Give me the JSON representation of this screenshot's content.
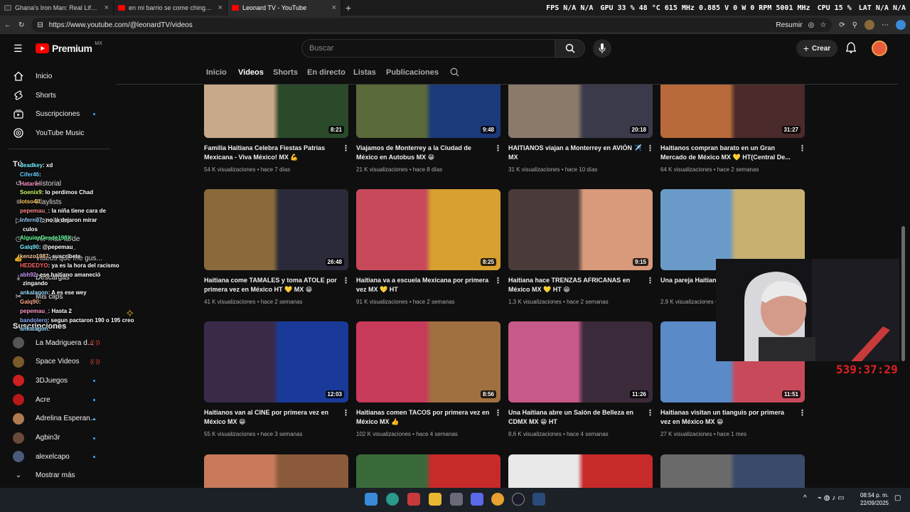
{
  "browser": {
    "tabs": [
      {
        "title": "Ghana's Iron Man: Real Life Waka",
        "active": false
      },
      {
        "title": "en mi barrio se come chingon - Yo",
        "active": false
      },
      {
        "title": "Leonard TV - YouTube",
        "active": true
      }
    ],
    "url": "https://www.youtube.com/@leonardTV/videos",
    "resumir": "Resumir"
  },
  "hud": {
    "fps_label": "FPS",
    "fps1": "N/A",
    "fps2": "N/A",
    "gpu_label": "GPU",
    "gpu_pct": "33 %",
    "gpu_temp": "48 °C",
    "gpu_clock": "615 MHz",
    "gpu_volt": "0.885 V",
    "gpu_watt": "0 W",
    "gpu_rpm": "0 RPM",
    "gpu_mem": "5001 MHz",
    "cpu_label": "CPU",
    "cpu_pct": "15 %",
    "lat_label": "LAT",
    "lat1": "N/A",
    "lat2": "N/A"
  },
  "youtube": {
    "logo": "Premium",
    "region": "MX",
    "search_placeholder": "Buscar",
    "create_label": "Crear"
  },
  "sidebar": {
    "main": [
      {
        "label": "Inicio",
        "icon": "home-icon"
      },
      {
        "label": "Shorts",
        "icon": "shorts-icon"
      },
      {
        "label": "Suscripciones",
        "icon": "subscriptions-icon"
      },
      {
        "label": "YouTube Music",
        "icon": "music-icon"
      }
    ],
    "you_label": "Tú",
    "you_items": [
      {
        "label": "Historial"
      },
      {
        "label": "Playlists"
      },
      {
        "label": "Tus videos"
      },
      {
        "label": "Ver más tarde"
      },
      {
        "label": "Videos que me gus..."
      },
      {
        "label": "Descargas"
      },
      {
        "label": "Mis clips"
      }
    ],
    "subs_label": "Suscripciones",
    "subs": [
      {
        "name": "La Madriguera d...",
        "live": true,
        "color": "#555"
      },
      {
        "name": "Space Videos",
        "live": true,
        "color": "#7a5a2a"
      },
      {
        "name": "3DJuegos",
        "live": false,
        "color": "#cc1f1f"
      },
      {
        "name": "Acre",
        "live": false,
        "color": "#b81818"
      },
      {
        "name": "Adrelina Esperan...",
        "live": false,
        "color": "#b07a50"
      },
      {
        "name": "Agbin3r",
        "live": false,
        "color": "#6a4a3a"
      },
      {
        "name": "alexelcapo",
        "live": false,
        "color": "#4a5a7a"
      }
    ],
    "show_more": "Mostrar más"
  },
  "chat": [
    {
      "user": "deadkey",
      "text": ": xd"
    },
    {
      "user": "Cifer46",
      "text": ":"
    },
    {
      "user": "Hatariel",
      "text": ""
    },
    {
      "user": "Soenix9",
      "text": ": lo perdimos Chad"
    },
    {
      "user": "lotso4d",
      "text": ""
    },
    {
      "user": "pepemau_",
      "text": ": la niña tiene cara de"
    },
    {
      "user": "Inferno7",
      "text": ": no la dejaron mirar"
    },
    {
      "user": "",
      "text": "culos"
    },
    {
      "user": "AlguienDesde198X",
      "text": ":"
    },
    {
      "user": "Galq90",
      "text": ": @pepemau_"
    },
    {
      "user": "kenzo1987",
      "text": ": suscribete"
    },
    {
      "user": "HEDEDYO",
      "text": ": ya es la hora del racismo"
    },
    {
      "user": "abh92",
      "text": ": ese haitiano amaneció"
    },
    {
      "user": "",
      "text": "zingando"
    },
    {
      "user": "ankalagon",
      "text": ": A es ese wey"
    },
    {
      "user": "Galq90",
      "text": ":"
    },
    {
      "user": "pepemau_",
      "text": ": Hasta 2"
    },
    {
      "user": "bandolero",
      "text": ": segun pactaron 190 o 195 creo"
    },
    {
      "user": "ankalagon",
      "text": ":"
    }
  ],
  "channel_tabs": [
    "Inicio",
    "Videos",
    "Shorts",
    "En directo",
    "Listas",
    "Publicaciones"
  ],
  "active_tab": "Videos",
  "videos": [
    {
      "title": "Familia Haitiana Celebra Fiestas Patrias Mexicana - Viva México! MX 💪",
      "views": "54 K visualizaciones",
      "age": "hace 7 días",
      "duration": "8:21",
      "c1": "#c8a98a",
      "c2": "#2a4a2a"
    },
    {
      "title": "Viajamos de Monterrey a la Ciudad de México en Autobus MX 😁",
      "views": "21 K visualizaciones",
      "age": "hace 8 días",
      "duration": "9:48",
      "c1": "#5a6a3a",
      "c2": "#1a3a7a"
    },
    {
      "title": "HAITIANOS viajan a Monterrey en AVIÓN ✈️ MX",
      "views": "31 K visualizaciones",
      "age": "hace 10 días",
      "duration": "20:18",
      "c1": "#8a7a6a",
      "c2": "#3a3a4a"
    },
    {
      "title": "Haitianos compran barato en un Gran Mercado de México MX 💛 HT(Central De...",
      "views": "64 K visualizaciones",
      "age": "hace 2 semanas",
      "duration": "31:27",
      "c1": "#b86a3a",
      "c2": "#4a2a2a"
    },
    {
      "title": "Haitiana come TAMALES y toma ATOLE por primera vez en México HT 💛 MX 😁",
      "views": "41 K visualizaciones",
      "age": "hace 2 semanas",
      "duration": "26:48",
      "c1": "#8a6a3a",
      "c2": "#2a2a3a"
    },
    {
      "title": "Haitiana va a escuela Mexicana por primera vez MX 💛 HT",
      "views": "91 K visualizaciones",
      "age": "hace 2 semanas",
      "duration": "8:25",
      "c1": "#c84a5a",
      "c2": "#d8a030"
    },
    {
      "title": "Haitiana hace TRENZAS AFRICANAS en México MX 💛 HT 😁",
      "views": "1,3 K visualizaciones",
      "age": "hace 2 semanas",
      "duration": "9:15",
      "c1": "#4a3a3a",
      "c2": "#d89a7a"
    },
    {
      "title": "Una pareja Haitiana abandonan USA US",
      "views": "2,9 K visualizaciones",
      "age": "hace 2 semanas",
      "duration": "",
      "c1": "#6a9ac8",
      "c2": "#c8b070"
    },
    {
      "title": "Haitianos van al CINE por primera vez en México MX 😁",
      "views": "55 K visualizaciones",
      "age": "hace 3 semanas",
      "duration": "12:03",
      "c1": "#3a2a4a",
      "c2": "#1a3a9a"
    },
    {
      "title": "Haitianas comen TACOS por primera vez en México MX 👍",
      "views": "102 K visualizaciones",
      "age": "hace 4 semanas",
      "duration": "8:56",
      "c1": "#c83a5a",
      "c2": "#a07040"
    },
    {
      "title": "Una Haitiana abre un Salón de Belleza en CDMX MX 😁 HT",
      "views": "8,6 K visualizaciones",
      "age": "hace 4 semanas",
      "duration": "11:26",
      "c1": "#c85a8a",
      "c2": "#3a2a3a"
    },
    {
      "title": "Haitianas visitan un tianguis por primera vez en México MX 😁",
      "views": "27 K visualizaciones",
      "age": "hace 1 mes",
      "duration": "11:51",
      "c1": "#5a8ac8",
      "c2": "#c84a5a"
    },
    {
      "title": "",
      "views": "",
      "age": "",
      "duration": "",
      "c1": "#c87a5a",
      "c2": "#8a5a3a"
    },
    {
      "title": "",
      "views": "",
      "age": "",
      "duration": "",
      "c1": "#3a6a3a",
      "c2": "#c82a2a"
    },
    {
      "title": "",
      "views": "",
      "age": "",
      "duration": "",
      "c1": "#e8e8e8",
      "c2": "#c82a2a"
    },
    {
      "title": "",
      "views": "",
      "age": "",
      "duration": "",
      "c1": "#6a6a6a",
      "c2": "#3a4a6a"
    }
  ],
  "stream": {
    "timer": "539:37:29"
  },
  "taskbar": {
    "time": "08:54 p. m.",
    "date": "22/09/2025"
  }
}
